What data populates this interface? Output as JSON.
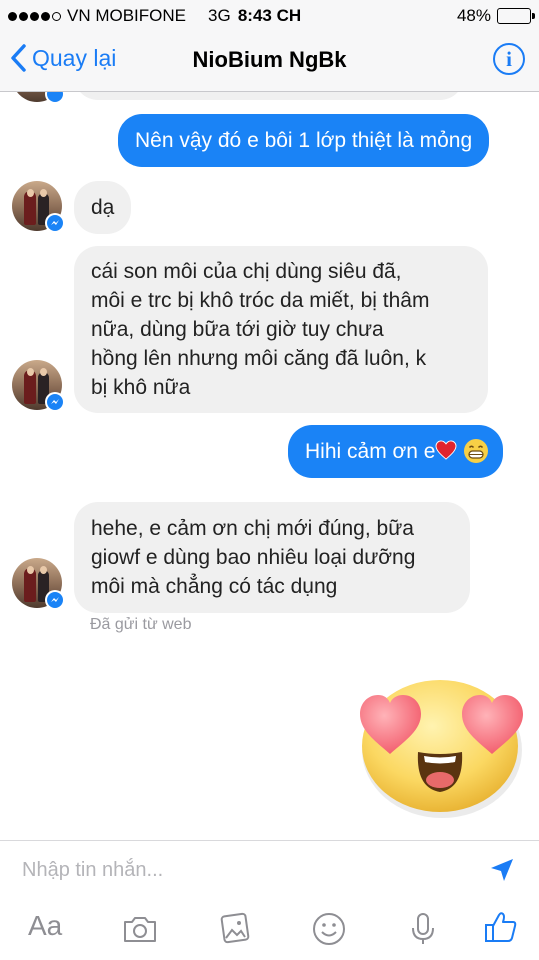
{
  "status_bar": {
    "carrier": "VN MOBIFONE",
    "network": "3G",
    "time": "8:43 CH",
    "battery_text": "48%",
    "battery_level": 0.48
  },
  "nav": {
    "back_label": "Quay lại",
    "title": "NioBium NgBk",
    "info_icon": "i"
  },
  "messages": [
    {
      "from": "me",
      "text": "Nên vậy đó e bôi 1 lớp thiệt là mỏng"
    },
    {
      "from": "them",
      "text": "dạ"
    },
    {
      "from": "them",
      "lines": [
        "cái son môi của chị dùng siêu đã,",
        "môi e trc bị khô tróc da miết, bị thâm",
        "nữa, dùng bữa tới giờ tuy chưa",
        "hồng lên nhưng môi căng đã luôn, k",
        "bị khô nữa"
      ]
    },
    {
      "from": "me",
      "text": "Hihi cảm ơn e",
      "emoji": [
        "heart-icon",
        "grinning-face-icon"
      ]
    },
    {
      "from": "them",
      "lines": [
        "hehe, e cảm ơn chị mới đúng, bữa",
        "giowf e dùng bao nhiêu loại dưỡng",
        "môi mà chẳng có tác dụng"
      ]
    }
  ],
  "sent_from": "Đã gửi từ web",
  "composer": {
    "placeholder": "Nhập tin nhắn...",
    "text_size_label": "Aa"
  },
  "colors": {
    "accent": "#1a7cf5",
    "outgoing_bubble": "#1a83f6",
    "incoming_bubble": "#f0f0f0"
  }
}
